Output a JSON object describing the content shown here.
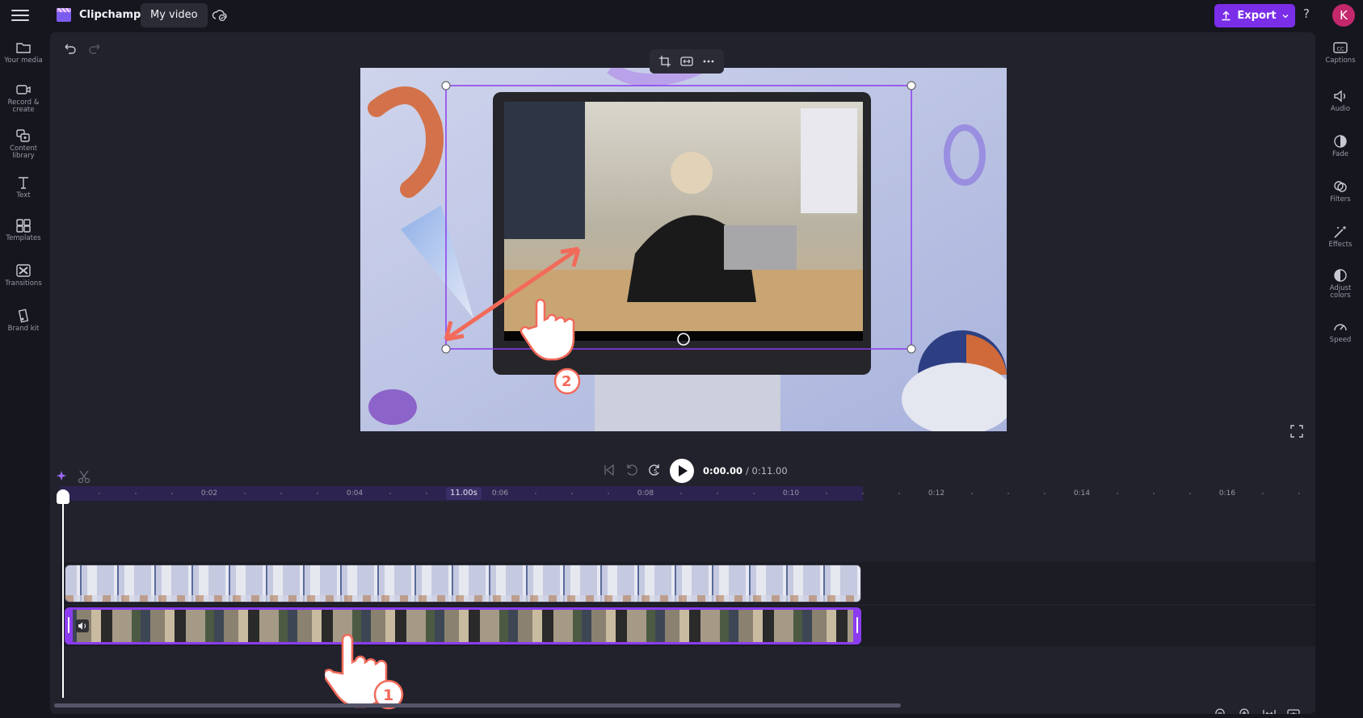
{
  "app": {
    "title": "Clipchamp",
    "video_name": "My video",
    "export_label": "Export",
    "help_label": "?",
    "avatar_initial": "K",
    "accent_color": "#7a2ee8"
  },
  "left_sidebar": {
    "items": [
      {
        "label": "Your media",
        "icon": "folder-icon"
      },
      {
        "label": "Record & create",
        "icon": "camera-icon"
      },
      {
        "label": "Content library",
        "icon": "library-icon"
      },
      {
        "label": "Text",
        "icon": "text-icon"
      },
      {
        "label": "Templates",
        "icon": "templates-icon"
      },
      {
        "label": "Transitions",
        "icon": "transitions-icon"
      },
      {
        "label": "Brand kit",
        "icon": "brand-kit-icon"
      }
    ]
  },
  "right_sidebar": {
    "items": [
      {
        "label": "Captions",
        "icon": "captions-icon"
      },
      {
        "label": "Audio",
        "icon": "speaker-icon"
      },
      {
        "label": "Fade",
        "icon": "fade-icon"
      },
      {
        "label": "Filters",
        "icon": "filters-icon"
      },
      {
        "label": "Effects",
        "icon": "magic-wand-icon"
      },
      {
        "label": "Adjust colors",
        "icon": "contrast-icon"
      },
      {
        "label": "Speed",
        "icon": "speedometer-icon"
      }
    ]
  },
  "player": {
    "current_time": "0:00.00",
    "total_time": "/ 0:11.00",
    "skip_label": "5"
  },
  "timeline": {
    "split_badge": "11.00s",
    "ticks": [
      "0:02",
      "0:04",
      "0:06",
      "0:08",
      "0:10",
      "0:12",
      "0:14",
      "0:16"
    ]
  },
  "annotations": {
    "step_1": "1",
    "step_2": "2"
  }
}
